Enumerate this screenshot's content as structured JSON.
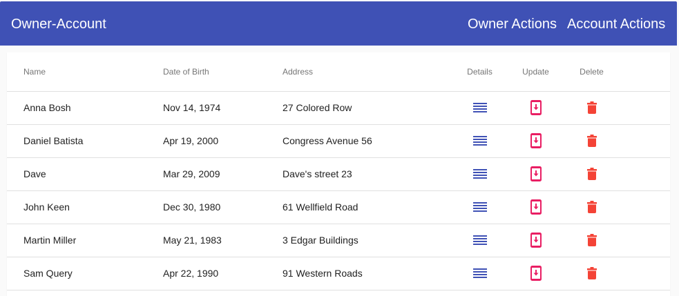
{
  "header": {
    "brand": "Owner-Account",
    "nav": [
      "Owner Actions",
      "Account Actions"
    ],
    "background_color": "#3f51b5"
  },
  "table": {
    "columns": [
      "Name",
      "Date of Birth",
      "Address",
      "Details",
      "Update",
      "Delete"
    ],
    "rows": [
      {
        "name": "Anna Bosh",
        "dob": "Nov 14, 1974",
        "address": "27 Colored Row"
      },
      {
        "name": "Daniel Batista",
        "dob": "Apr 19, 2000",
        "address": "Congress Avenue 56"
      },
      {
        "name": "Dave",
        "dob": "Mar 29, 2009",
        "address": "Dave's street 23"
      },
      {
        "name": "John Keen",
        "dob": "Dec 30, 1980",
        "address": "61 Wellfield Road"
      },
      {
        "name": "Martin Miller",
        "dob": "May 21, 1983",
        "address": "3 Edgar Buildings"
      },
      {
        "name": "Sam Query",
        "dob": "Apr 22, 1990",
        "address": "91 Western Roads"
      }
    ],
    "icons": {
      "details": "reorder-icon",
      "update": "system-update-icon",
      "delete": "delete-icon"
    },
    "colors": {
      "details": "#3f51b5",
      "update": "#e91e63",
      "delete": "#f44336"
    }
  }
}
